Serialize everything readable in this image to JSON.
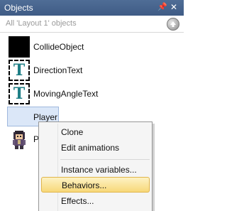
{
  "panel": {
    "title": "Objects",
    "pin_icon": "pin-icon",
    "close_icon": "close-icon"
  },
  "filter": {
    "label": "All 'Layout 1' objects",
    "up_icon": "circle-up-arrow-icon"
  },
  "objects": [
    {
      "label": "CollideObject",
      "thumb": "black-square"
    },
    {
      "label": "DirectionText",
      "thumb": "text-object-icon",
      "glyph": "T"
    },
    {
      "label": "MovingAngleText",
      "thumb": "text-object-icon",
      "glyph": "T"
    },
    {
      "label": "Player",
      "selected": true
    },
    {
      "label": "P",
      "thumb": "character-sprite"
    }
  ],
  "context_menu": {
    "items": [
      {
        "label": "Clone"
      },
      {
        "label": "Edit animations"
      },
      {
        "label": "Instance variables..."
      },
      {
        "label": "Behaviors...",
        "highlighted": true
      },
      {
        "label": "Effects..."
      }
    ]
  },
  "colors": {
    "titlebar": "#4f6d96",
    "selection": "#dbe7f8",
    "menu_highlight": "#f7d879",
    "text_icon": "#1f7f86"
  }
}
